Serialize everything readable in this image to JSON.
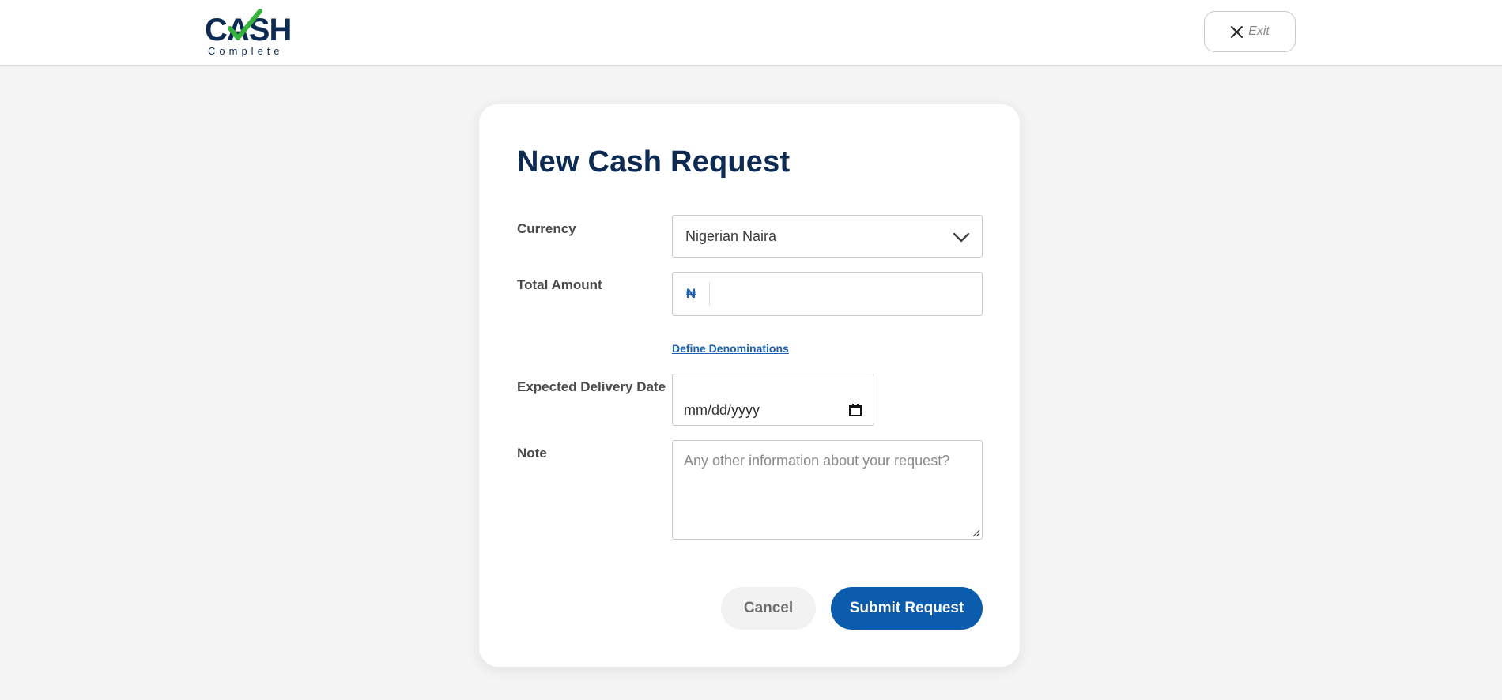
{
  "brand": {
    "logo_word": "CASH",
    "logo_sub": "Complete",
    "primary_color": "#0d2b52",
    "accent_color": "#35b33a",
    "button_color": "#0b5cad"
  },
  "header": {
    "exit_label": "Exit",
    "exit_icon": "close-icon"
  },
  "form": {
    "title": "New Cash Request",
    "currency": {
      "label": "Currency",
      "selected": "Nigerian Naira"
    },
    "amount": {
      "label": "Total Amount",
      "symbol": "₦",
      "value": ""
    },
    "denominations_link": "Define Denominations",
    "delivery_date": {
      "label": "Expected Delivery Date",
      "placeholder": "mm/dd/yyyy"
    },
    "note": {
      "label": "Note",
      "placeholder": "Any other information about your request?"
    },
    "cancel_label": "Cancel",
    "submit_label": "Submit Request"
  }
}
